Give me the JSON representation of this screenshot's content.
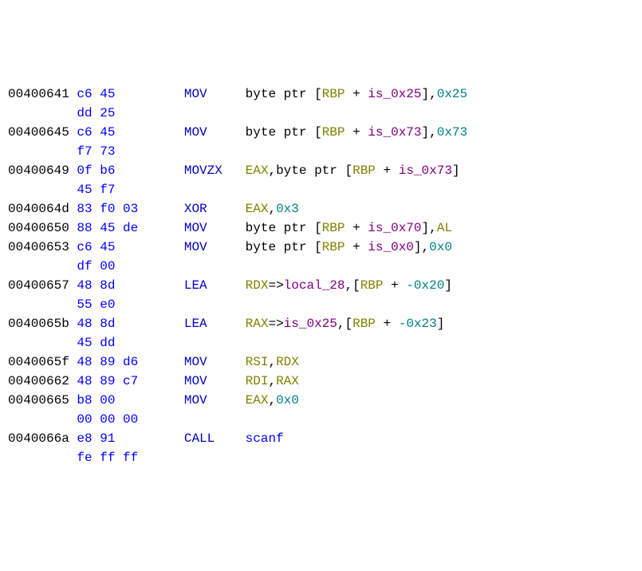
{
  "listing": [
    {
      "addr": "00400641",
      "bytes1": "c6 45",
      "bytes2": "dd 25",
      "mnemonic": "MOV",
      "ops": [
        {
          "t": "black",
          "v": "byte ptr ["
        },
        {
          "t": "reg",
          "v": "RBP"
        },
        {
          "t": "black",
          "v": " + "
        },
        {
          "t": "var",
          "v": "is_0x25"
        },
        {
          "t": "black",
          "v": "],"
        },
        {
          "t": "num",
          "v": "0x25"
        }
      ]
    },
    {
      "addr": "00400645",
      "bytes1": "c6 45",
      "bytes2": "f7 73",
      "mnemonic": "MOV",
      "ops": [
        {
          "t": "black",
          "v": "byte ptr ["
        },
        {
          "t": "reg",
          "v": "RBP"
        },
        {
          "t": "black",
          "v": " + "
        },
        {
          "t": "var",
          "v": "is_0x73"
        },
        {
          "t": "black",
          "v": "],"
        },
        {
          "t": "num",
          "v": "0x73"
        }
      ]
    },
    {
      "addr": "00400649",
      "bytes1": "0f b6",
      "bytes2": "45 f7",
      "mnemonic": "MOVZX",
      "ops": [
        {
          "t": "reg",
          "v": "EAX"
        },
        {
          "t": "black",
          "v": ",byte ptr ["
        },
        {
          "t": "reg",
          "v": "RBP"
        },
        {
          "t": "black",
          "v": " + "
        },
        {
          "t": "var",
          "v": "is_0x73"
        },
        {
          "t": "black",
          "v": "]"
        }
      ]
    },
    {
      "addr": "0040064d",
      "bytes1": "83 f0 03",
      "mnemonic": "XOR",
      "ops": [
        {
          "t": "reg",
          "v": "EAX"
        },
        {
          "t": "black",
          "v": ","
        },
        {
          "t": "num",
          "v": "0x3"
        }
      ]
    },
    {
      "addr": "00400650",
      "bytes1": "88 45 de",
      "mnemonic": "MOV",
      "ops": [
        {
          "t": "black",
          "v": "byte ptr ["
        },
        {
          "t": "reg",
          "v": "RBP"
        },
        {
          "t": "black",
          "v": " + "
        },
        {
          "t": "var",
          "v": "is_0x70"
        },
        {
          "t": "black",
          "v": "],"
        },
        {
          "t": "reg",
          "v": "AL"
        }
      ]
    },
    {
      "addr": "00400653",
      "bytes1": "c6 45",
      "bytes2": "df 00",
      "mnemonic": "MOV",
      "ops": [
        {
          "t": "black",
          "v": "byte ptr ["
        },
        {
          "t": "reg",
          "v": "RBP"
        },
        {
          "t": "black",
          "v": " + "
        },
        {
          "t": "var",
          "v": "is_0x0"
        },
        {
          "t": "black",
          "v": "],"
        },
        {
          "t": "num",
          "v": "0x0"
        }
      ]
    },
    {
      "addr": "00400657",
      "bytes1": "48 8d",
      "bytes2": "55 e0",
      "mnemonic": "LEA",
      "ops": [
        {
          "t": "reg",
          "v": "RDX"
        },
        {
          "t": "black",
          "v": "=>"
        },
        {
          "t": "var",
          "v": "local_28"
        },
        {
          "t": "black",
          "v": ",["
        },
        {
          "t": "reg",
          "v": "RBP"
        },
        {
          "t": "black",
          "v": " + "
        },
        {
          "t": "num",
          "v": "-0x20"
        },
        {
          "t": "black",
          "v": "]"
        }
      ]
    },
    {
      "addr": "0040065b",
      "bytes1": "48 8d",
      "bytes2": "45 dd",
      "mnemonic": "LEA",
      "ops": [
        {
          "t": "reg",
          "v": "RAX"
        },
        {
          "t": "black",
          "v": "=>"
        },
        {
          "t": "var",
          "v": "is_0x25"
        },
        {
          "t": "black",
          "v": ",["
        },
        {
          "t": "reg",
          "v": "RBP"
        },
        {
          "t": "black",
          "v": " + "
        },
        {
          "t": "num",
          "v": "-0x23"
        },
        {
          "t": "black",
          "v": "]"
        }
      ]
    },
    {
      "addr": "0040065f",
      "bytes1": "48 89 d6",
      "mnemonic": "MOV",
      "ops": [
        {
          "t": "reg",
          "v": "RSI"
        },
        {
          "t": "black",
          "v": ","
        },
        {
          "t": "reg",
          "v": "RDX"
        }
      ]
    },
    {
      "addr": "00400662",
      "bytes1": "48 89 c7",
      "mnemonic": "MOV",
      "ops": [
        {
          "t": "reg",
          "v": "RDI"
        },
        {
          "t": "black",
          "v": ","
        },
        {
          "t": "reg",
          "v": "RAX"
        }
      ]
    },
    {
      "addr": "00400665",
      "bytes1": "b8 00",
      "bytes2": "00 00 00",
      "mnemonic": "MOV",
      "ops": [
        {
          "t": "reg",
          "v": "EAX"
        },
        {
          "t": "black",
          "v": ","
        },
        {
          "t": "num",
          "v": "0x0"
        }
      ]
    },
    {
      "addr": "0040066a",
      "bytes1": "e8 91",
      "bytes2": "fe ff ff",
      "mnemonic": "CALL",
      "ops": [
        {
          "t": "func",
          "v": "scanf"
        }
      ]
    }
  ],
  "columns": {
    "addr_width": 9,
    "bytes_width": 14,
    "mnemonic_width": 8
  }
}
